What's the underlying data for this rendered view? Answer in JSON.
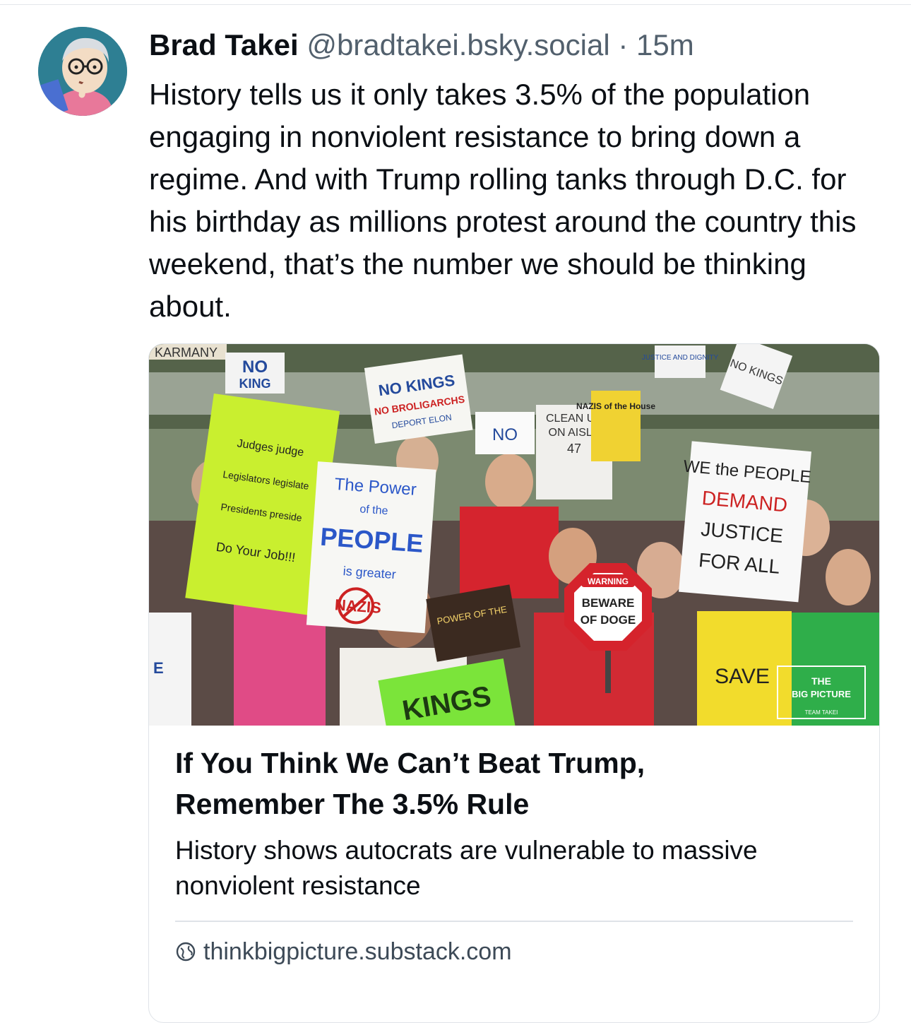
{
  "post": {
    "author_name": "Brad Takei",
    "author_handle": "@bradtakei.bsky.social",
    "separator": "·",
    "timestamp": "15m",
    "text": "History tells us it only takes 3.5% of the population engaging in nonviolent resistance to bring down a regime. And with Trump rolling tanks through D.C. for his birthday as millions protest around the country this weekend, that’s the number we should be thinking about.",
    "avatar_icon": "cartoon-avatar-icon"
  },
  "embed": {
    "title_line1": "If You Think We Can’t Beat Trump,",
    "title_line2": "Remember The 3.5% Rule",
    "description": "History shows autocrats are vulnerable to massive nonviolent resistance",
    "domain": "thinkbigpicture.substack.com",
    "domain_icon": "globe-icon",
    "image": {
      "signs": {
        "no_kings_top": "NO KINGS",
        "no_broligarchs": "NO BROLIGARCHS",
        "deport_elon": "DEPORT ELON",
        "no_kings_right": "NO KINGS",
        "justice_dignity": "JUSTICE AND DIGNITY",
        "clean_up_line1": "CLEAN UP",
        "clean_up_line2": "ON AISLE",
        "clean_up_line3": "47",
        "nazis": "NAZIS of the House",
        "judges_line1": "Judges judge",
        "judges_line2": "Legislators legislate",
        "judges_line3": "Presidents preside",
        "judges_line4": "Do Your Job!!!",
        "power_line1": "The Power",
        "power_line2": "of the",
        "power_line3": "PEOPLE",
        "power_line4": "is greater",
        "we_people_line1": "WE the PEOPLE",
        "we_people_line2": "DEMAND",
        "we_people_line3": "JUSTICE",
        "we_people_line4": "FOR ALL",
        "warning_top": "WARNING",
        "warning_line1": "BEWARE",
        "warning_line2": "OF DOGE",
        "kings_bottom": "KINGS",
        "save": "SAVE",
        "no_partial": "NO",
        "karmany": "KARMANY",
        "power_of_the": "POWER OF THE",
        "nazis_crossed": "NAZIS"
      },
      "watermark_line1": "THE",
      "watermark_line2": "BIG PICTURE",
      "watermark_line3": "TEAM TAKEI"
    }
  },
  "colors": {
    "text": "#0b0f14",
    "muted": "#52606d",
    "border": "#dfe3e8"
  }
}
